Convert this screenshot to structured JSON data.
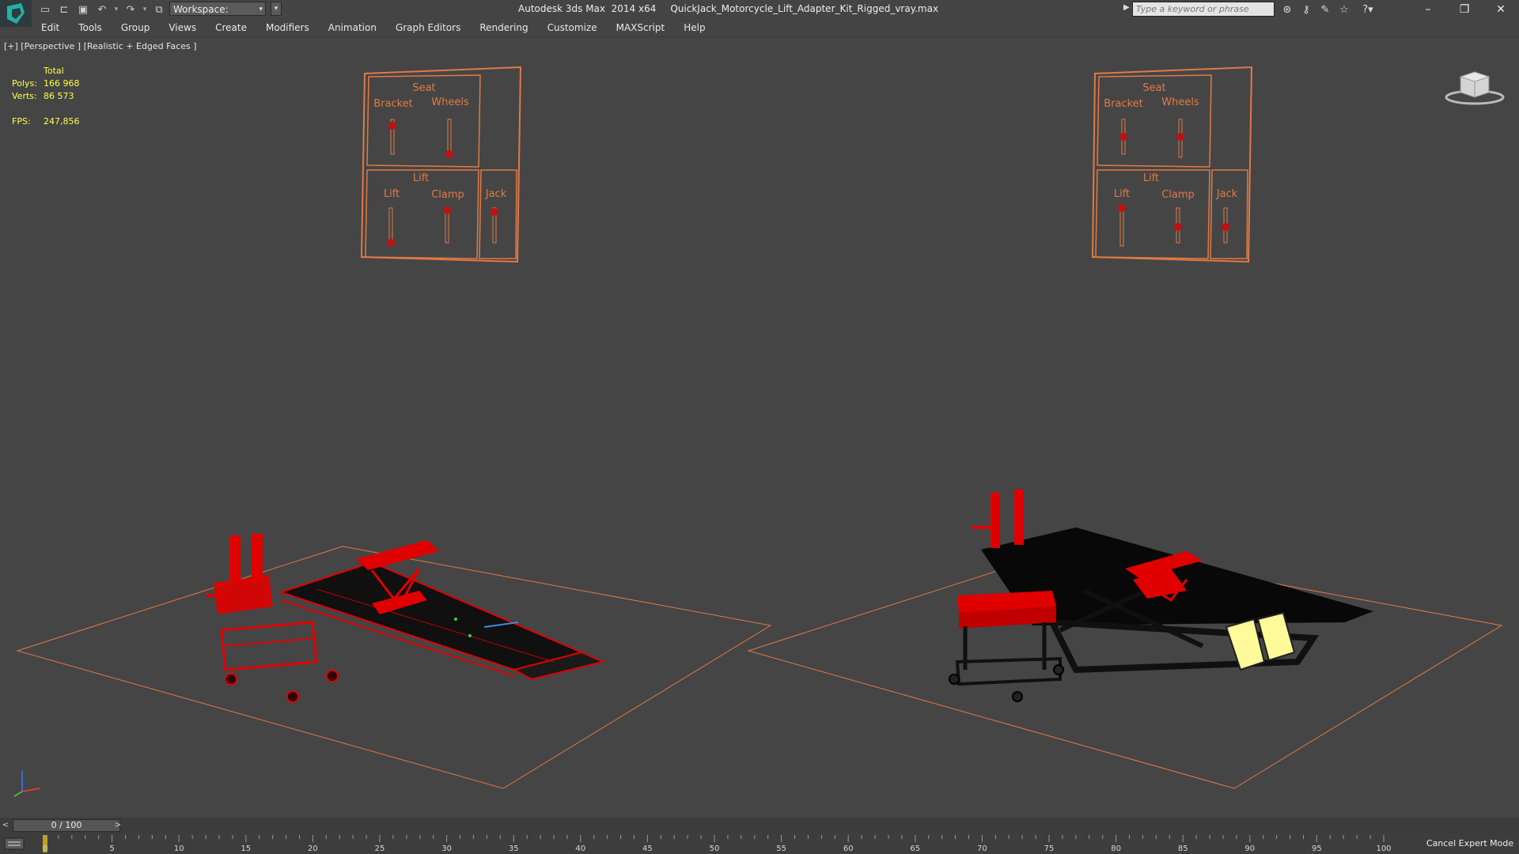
{
  "app": {
    "title": "Autodesk 3ds Max  2014 x64",
    "file": "QuickJack_Motorcycle_Lift_Adapter_Kit_Rigged_vray.max"
  },
  "workspace": {
    "label": "Workspace: Default"
  },
  "search": {
    "placeholder": "Type a keyword or phrase"
  },
  "menu": [
    "Edit",
    "Tools",
    "Group",
    "Views",
    "Create",
    "Modifiers",
    "Animation",
    "Graph Editors",
    "Rendering",
    "Customize",
    "MAXScript",
    "Help"
  ],
  "viewport": {
    "label": "[+] [Perspective ] [Realistic + Edged Faces ]",
    "stats": {
      "header": "Total",
      "polys_label": "Polys:",
      "polys": "166 968",
      "verts_label": "Verts:",
      "verts": "86 573",
      "fps_label": "FPS:",
      "fps": "247,856"
    }
  },
  "control_panels": [
    {
      "seat_title": "Seat",
      "bracket": "Bracket",
      "wheels": "Wheels",
      "lift_title": "Lift",
      "lift": "Lift",
      "clamp": "Clamp",
      "jack": "Jack"
    },
    {
      "seat_title": "Seat",
      "bracket": "Bracket",
      "wheels": "Wheels",
      "lift_title": "Lift",
      "lift": "Lift",
      "clamp": "Clamp",
      "jack": "Jack"
    }
  ],
  "timeline": {
    "frame_label": "0 / 100",
    "ticks": [
      "0",
      "5",
      "10",
      "15",
      "20",
      "25",
      "30",
      "35",
      "40",
      "45",
      "50",
      "55",
      "60",
      "65",
      "70",
      "75",
      "80",
      "85",
      "90",
      "95",
      "100"
    ]
  },
  "status": {
    "cancel_expert": "Cancel Expert Mode"
  },
  "colors": {
    "accent_orange": "#e07a45",
    "object_red": "#e00000",
    "stats_yellow": "#ffff4a",
    "viewport_bg": "#454545"
  },
  "icons": [
    "app-logo-icon",
    "new-file-icon",
    "open-file-icon",
    "save-icon",
    "undo-icon",
    "redo-icon",
    "project-folder-icon",
    "binoculars-icon",
    "key-icon",
    "communication-icon",
    "star-icon",
    "help-icon",
    "minimize-icon",
    "maximize-icon",
    "close-icon",
    "viewcube-icon",
    "axis-tripod-icon",
    "track-toggle-icon"
  ]
}
